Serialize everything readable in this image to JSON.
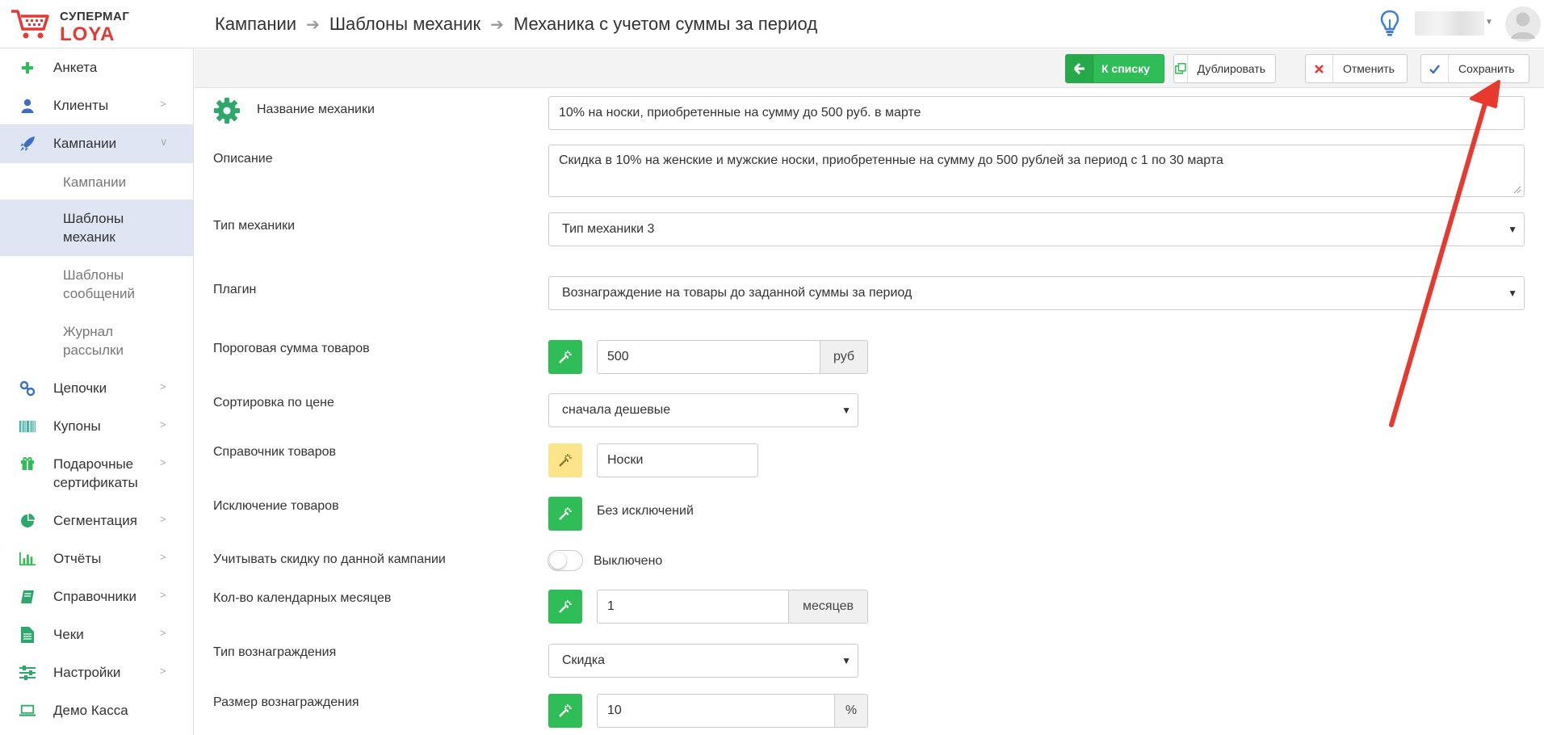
{
  "logo": {
    "line1": "СУПЕРМАГ",
    "line2": "LOYA"
  },
  "breadcrumb": [
    "Кампании",
    "Шаблоны механик",
    "Механика с учетом суммы за период"
  ],
  "sidebar": {
    "items": [
      {
        "label": "Анкета",
        "icon": "plus-icon"
      },
      {
        "label": "Клиенты",
        "icon": "user-icon"
      },
      {
        "label": "Кампании",
        "icon": "rocket-icon"
      },
      {
        "label": "Цепочки",
        "icon": "link-icon"
      },
      {
        "label": "Купоны",
        "icon": "barcode-icon"
      },
      {
        "label": "Подарочные сертификаты",
        "icon": "gift-icon"
      },
      {
        "label": "Сегментация",
        "icon": "pie-chart-icon"
      },
      {
        "label": "Отчёты",
        "icon": "bar-chart-icon"
      },
      {
        "label": "Справочники",
        "icon": "book-icon"
      },
      {
        "label": "Чеки",
        "icon": "file-icon"
      },
      {
        "label": "Настройки",
        "icon": "sliders-icon"
      },
      {
        "label": "Демо Касса",
        "icon": "laptop-icon"
      }
    ],
    "subitems": [
      "Кампании",
      "Шаблоны механик",
      "Шаблоны сообщений",
      "Журнал рассылки"
    ]
  },
  "toolbar": {
    "back_label": "К списку",
    "duplicate_label": "Дублировать",
    "cancel_label": "Отменить",
    "save_label": "Сохранить"
  },
  "form": {
    "name_label": "Название механики",
    "name_value": "10% на носки, приобретенные на сумму до 500 руб. в марте",
    "description_label": "Описание",
    "description_value": "Скидка в 10% на женские и мужские носки, приобретенные на сумму до 500 рублей за период с 1 по 30 марта",
    "type_label": "Тип механики",
    "type_value": "Тип механики 3",
    "plugin_label": "Плагин",
    "plugin_value": "Вознаграждение на товары до заданной суммы за период",
    "threshold_label": "Пороговая сумма товаров",
    "threshold_value": "500",
    "threshold_unit": "руб",
    "sort_label": "Сортировка по цене",
    "sort_value": "сначала дешевые",
    "catalog_label": "Справочник товаров",
    "catalog_value": "Носки",
    "exclusion_label": "Исключение товаров",
    "exclusion_value": "Без исключений",
    "discount_label": "Учитывать скидку по данной кампании",
    "discount_state": "Выключено",
    "months_label": "Кол-во календарных месяцев",
    "months_value": "1",
    "months_unit": "месяцев",
    "reward_type_label": "Тип вознаграждения",
    "reward_type_value": "Скидка",
    "reward_size_label": "Размер вознаграждения",
    "reward_size_value": "10",
    "reward_size_unit": "%"
  },
  "colors": {
    "accent_green": "#2ebd56",
    "brand_red": "#e53935",
    "arrow_red": "#e8392f",
    "active_bg": "#dfe5f2"
  }
}
